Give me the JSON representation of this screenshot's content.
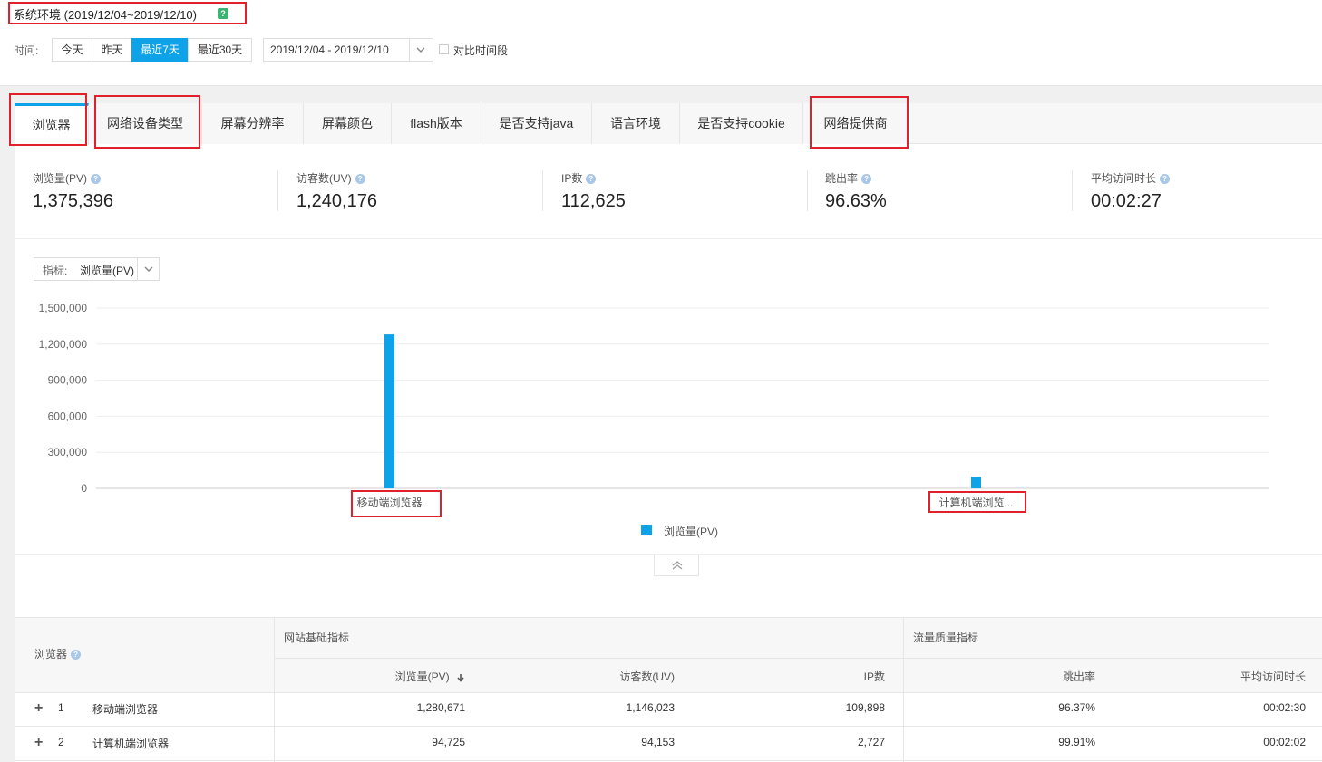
{
  "header": {
    "title": "系统环境 (2019/12/04~2019/12/10)",
    "help_badge": "?",
    "time_label": "时间:",
    "ranges": [
      "今天",
      "昨天",
      "最近7天",
      "最近30天"
    ],
    "active_range": "最近7天",
    "date_range": "2019/12/04 - 2019/12/10",
    "compare_label": "对比时间段"
  },
  "tabs": [
    {
      "label": "浏览器",
      "active": true
    },
    {
      "label": "网络设备类型"
    },
    {
      "label": "屏幕分辨率"
    },
    {
      "label": "屏幕颜色"
    },
    {
      "label": "flash版本"
    },
    {
      "label": "是否支持java"
    },
    {
      "label": "语言环境"
    },
    {
      "label": "是否支持cookie"
    },
    {
      "label": "网络提供商"
    }
  ],
  "metrics": [
    {
      "label": "浏览量(PV)",
      "value": "1,375,396"
    },
    {
      "label": "访客数(UV)",
      "value": "1,240,176"
    },
    {
      "label": "IP数",
      "value": "112,625"
    },
    {
      "label": "跳出率",
      "value": "96.63%"
    },
    {
      "label": "平均访问时长",
      "value": "00:02:27"
    }
  ],
  "indicator": {
    "label": "指标:",
    "value": "浏览量(PV)"
  },
  "chart_data": {
    "type": "bar",
    "categories": [
      "移动端浏览器",
      "计算机端浏览..."
    ],
    "series": [
      {
        "name": "浏览量(PV)",
        "values": [
          1280671,
          94725
        ],
        "color": "#0ea2e8"
      }
    ],
    "ylim": [
      0,
      1500000
    ],
    "yticks": [
      "1,500,000",
      "1,200,000",
      "900,000",
      "600,000",
      "300,000",
      "0"
    ],
    "ytick_values": [
      1500000,
      1200000,
      900000,
      600000,
      300000,
      0
    ],
    "grid": true,
    "legend": "bottom-center"
  },
  "table": {
    "dim_header": "浏览器",
    "group1": "网站基础指标",
    "group2": "流量质量指标",
    "columns": [
      "浏览量(PV)",
      "访客数(UV)",
      "IP数",
      "跳出率",
      "平均访问时长"
    ],
    "rows": [
      {
        "expand": "+",
        "index": "1",
        "name": "移动端浏览器",
        "pv": "1,280,671",
        "uv": "1,146,023",
        "ip": "109,898",
        "bounce": "96.37%",
        "avg": "00:02:30"
      },
      {
        "expand": "+",
        "index": "2",
        "name": "计算机端浏览器",
        "pv": "94,725",
        "uv": "94,153",
        "ip": "2,727",
        "bounce": "99.91%",
        "avg": "00:02:02"
      }
    ]
  }
}
